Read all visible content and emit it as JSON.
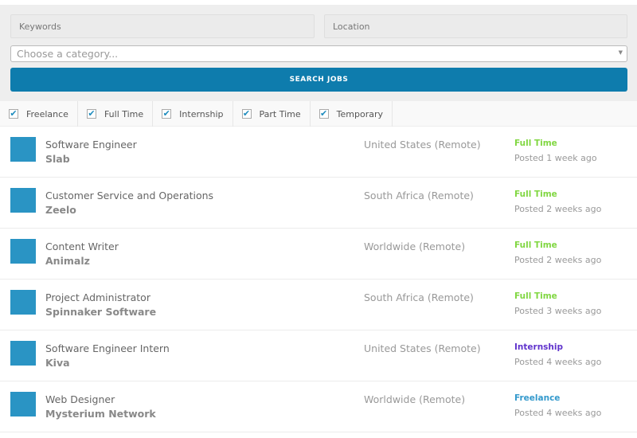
{
  "search": {
    "keywords_placeholder": "Keywords",
    "location_placeholder": "Location",
    "category_placeholder": "Choose a category...",
    "submit_label": "SEARCH JOBS"
  },
  "filters": [
    {
      "label": "Freelance",
      "checked": true
    },
    {
      "label": "Full Time",
      "checked": true
    },
    {
      "label": "Internship",
      "checked": true
    },
    {
      "label": "Part Time",
      "checked": true
    },
    {
      "label": "Temporary",
      "checked": true
    }
  ],
  "colors": {
    "accent": "#0e7cad",
    "full_time": "#81d742",
    "internship": "#6033cc",
    "freelance": "#3399cc"
  },
  "jobs": [
    {
      "title": "Software Engineer",
      "company": "Slab",
      "location": "United States (Remote)",
      "type": "Full Time",
      "type_color": "#81d742",
      "posted": "Posted 1 week ago"
    },
    {
      "title": "Customer Service and Operations",
      "company": "Zeelo",
      "location": "South Africa (Remote)",
      "type": "Full Time",
      "type_color": "#81d742",
      "posted": "Posted 2 weeks ago"
    },
    {
      "title": "Content Writer",
      "company": "Animalz",
      "location": "Worldwide (Remote)",
      "type": "Full Time",
      "type_color": "#81d742",
      "posted": "Posted 2 weeks ago"
    },
    {
      "title": "Project Administrator",
      "company": "Spinnaker Software",
      "location": "South Africa (Remote)",
      "type": "Full Time",
      "type_color": "#81d742",
      "posted": "Posted 3 weeks ago"
    },
    {
      "title": "Software Engineer Intern",
      "company": "Kiva",
      "location": "United States (Remote)",
      "type": "Internship",
      "type_color": "#6033cc",
      "posted": "Posted 4 weeks ago"
    },
    {
      "title": "Web Designer",
      "company": "Mysterium Network",
      "location": "Worldwide (Remote)",
      "type": "Freelance",
      "type_color": "#3399cc",
      "posted": "Posted 4 weeks ago"
    }
  ]
}
